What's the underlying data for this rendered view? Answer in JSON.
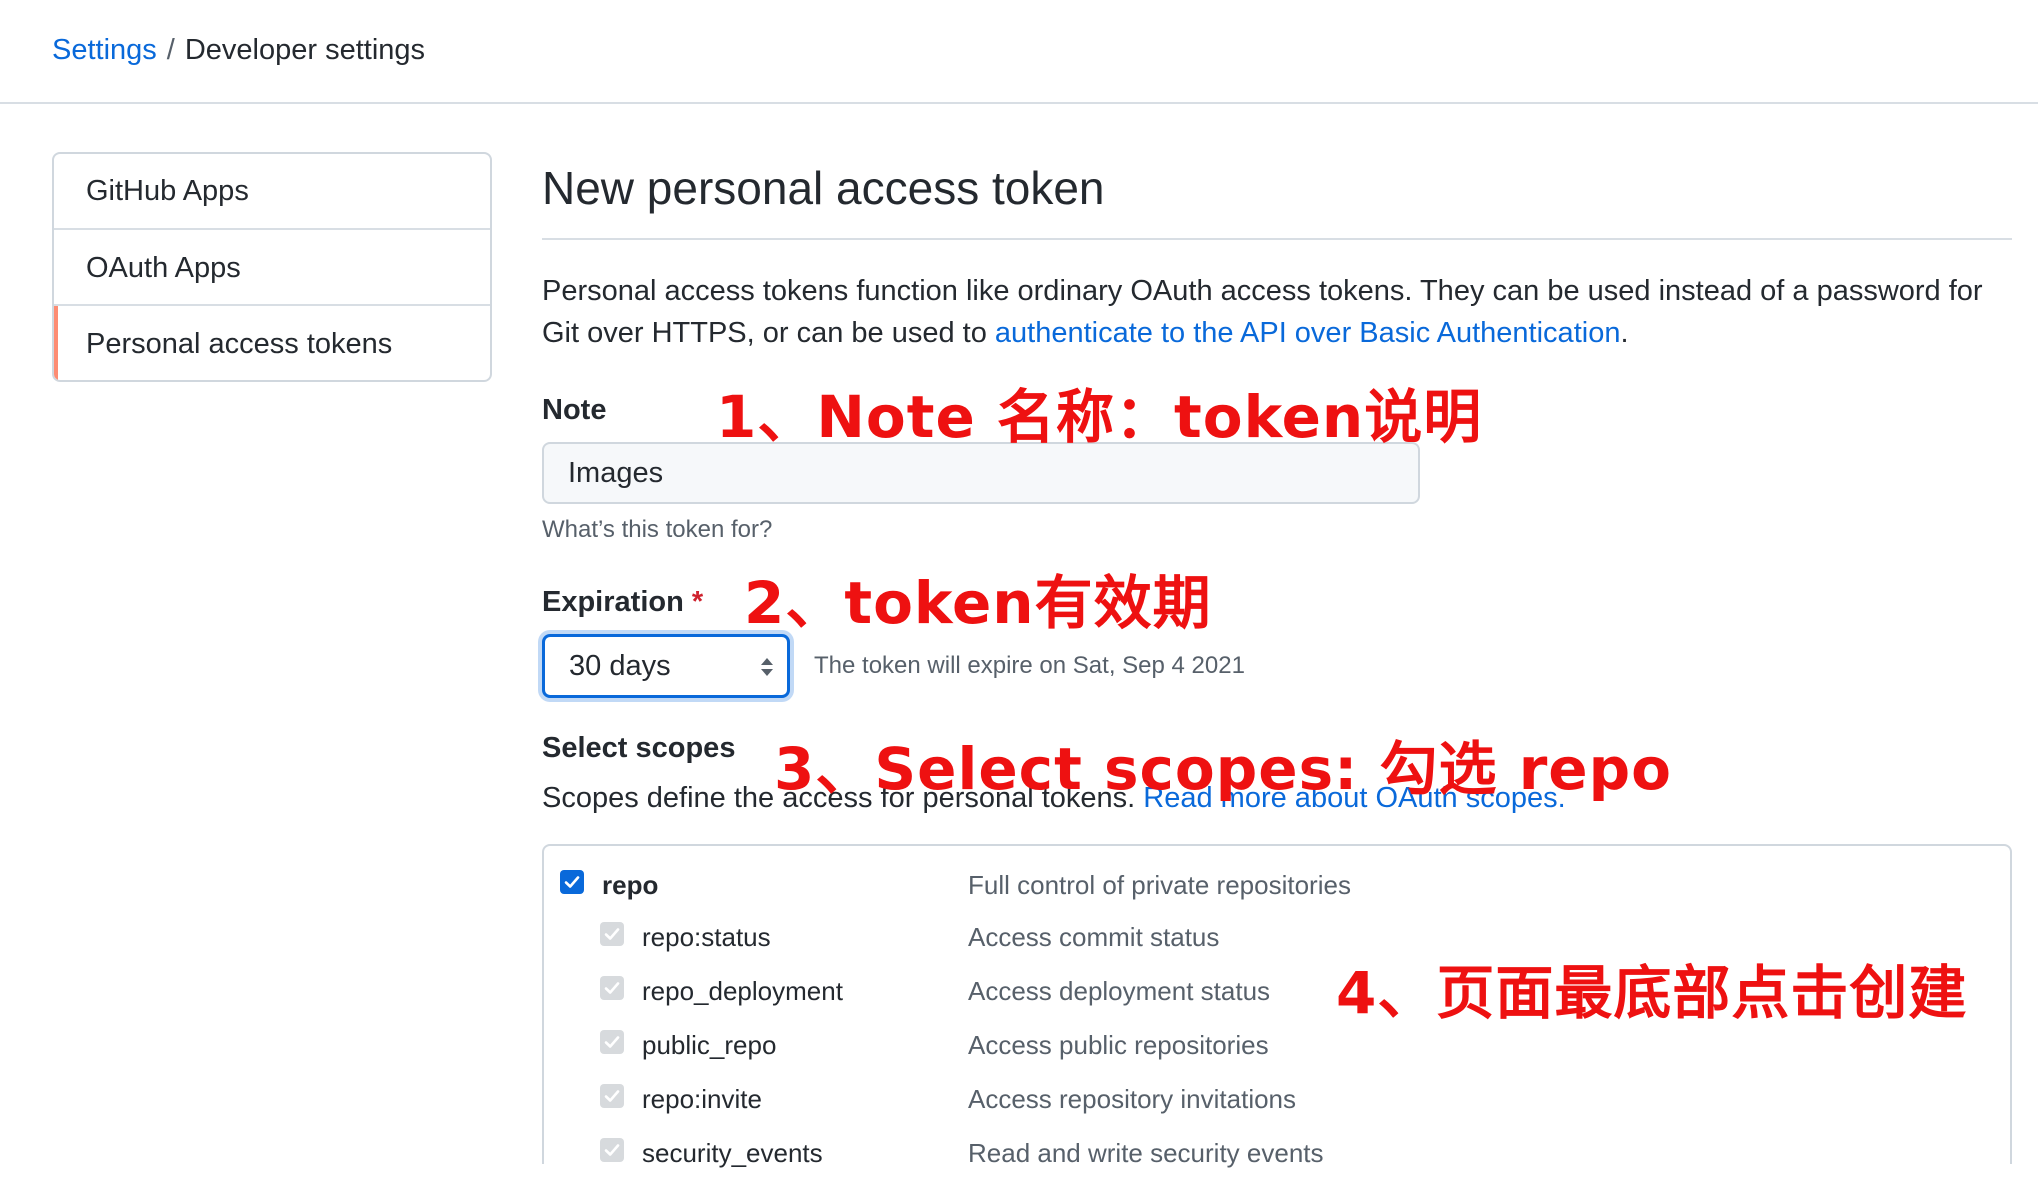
{
  "breadcrumb": {
    "settings": "Settings",
    "separator": "/",
    "current": "Developer settings"
  },
  "sidebar": {
    "items": [
      {
        "label": "GitHub Apps",
        "active": false
      },
      {
        "label": "OAuth Apps",
        "active": false
      },
      {
        "label": "Personal access tokens",
        "active": true
      }
    ]
  },
  "main": {
    "title": "New personal access token",
    "intro_text": "Personal access tokens function like ordinary OAuth access tokens. They can be used instead of a password for Git over HTTPS, or can be used to ",
    "intro_link": "authenticate to the API over Basic Authentication",
    "intro_end": "."
  },
  "note": {
    "label": "Note",
    "value": "Images",
    "help": "What’s this token for?"
  },
  "expiration": {
    "label": "Expiration",
    "required_mark": "*",
    "selected": "30 days",
    "help": "The token will expire on Sat, Sep 4 2021"
  },
  "scopes": {
    "label": "Select scopes",
    "desc": "Scopes define the access for personal tokens. ",
    "desc_link": "Read more about OAuth scopes.",
    "items": [
      {
        "name": "repo",
        "desc": "Full control of private repositories",
        "checked": true,
        "child": false
      },
      {
        "name": "repo:status",
        "desc": "Access commit status",
        "checked": true,
        "child": true
      },
      {
        "name": "repo_deployment",
        "desc": "Access deployment status",
        "checked": true,
        "child": true
      },
      {
        "name": "public_repo",
        "desc": "Access public repositories",
        "checked": true,
        "child": true
      },
      {
        "name": "repo:invite",
        "desc": "Access repository invitations",
        "checked": true,
        "child": true
      },
      {
        "name": "security_events",
        "desc": "Read and write security events",
        "checked": true,
        "child": true
      }
    ]
  },
  "annotations": {
    "step1": "1、Note 名称：token说明",
    "step2": "2、token有效期",
    "step3": "3、Select scopes: 勾选 repo",
    "step4": "4、页面最底部点击创建"
  },
  "colors": {
    "link": "#0969da",
    "annotation": "#ee1111",
    "active_marker": "#fd8c73",
    "checkbox": "#0969da"
  }
}
